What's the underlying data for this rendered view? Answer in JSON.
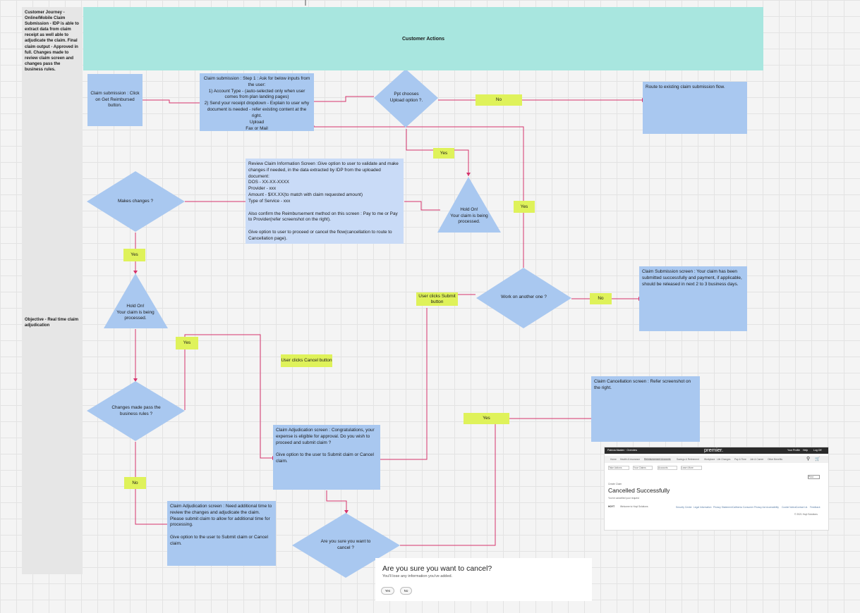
{
  "lane": {
    "row1_label": "Customer Journey - Online/Mobile  Claim Submission - IDP is able to extract data from claim receipt as well able to adjudicate the claim. Final claim output - Approved in full. Changes made to review claim screen and changes pass the business rules.",
    "row2_label": "Objective - Real time claim adjudication",
    "header_title": "Customer Actions"
  },
  "nodes": {
    "click_reimbursed": "Claim submission : Click on Get Reimbursed button.",
    "step1": "Claim submission : Step 1 : Ask for below inputs from the user:\n1) Account Type - (auto-selected only when user comes from plan landing pages)\n2) Send your receipt dropdown - Explain to user why document is needed - refer existing content at the right.\nUpload\nFax or Mail",
    "ppt_chooses": "Ppt chooses Upload option ?.",
    "route_existing": "Route to existing claim submission flow.",
    "review_screen": "Review Claim Information Screen :Give option to user to validate and make changes if needed, in the data extracted by IDP from the uploaded document:\nDOS - XX-XX-XXXX\nProvider - xxx\nAmount - $XX.XX(to match with claim requested amount)\nType of Service - xxx\n\nAlso confirm the Reimbursement method on this screen : Pay to me or Pay to Provider(refer screenshot on the right).\n\nGive option to user to proceed or cancel the flow(cancellation to route to Cancellation page).",
    "makes_changes": "Makes changes ?",
    "hold_on_1": "Hold On!\nYour claim is being processed.",
    "hold_on_2": "Hold On!\nYour claim is being processed.",
    "work_another": "Work on another one ?",
    "submission_screen": "Claim Submission screen : Your claim has been submitted successfully and payment, if applicable, should be released in next 2 to 3 business days.",
    "user_submit": "User clicks Submit button",
    "user_cancel": "User clicks Cancel button",
    "changes_pass": "Changes made pass the business rules ?",
    "adjudication_congrats": "Claim Adjudication screen : Congratulations, your expense is eligible for approval. Do you wish to proceed and submit claim ?\n\nGive option to the user to Submit claim or Cancel claim.",
    "cancellation_screen": "Claim Cancellation screen : Refer screenshot on the right.",
    "adjudication_more_time": "Claim Adjudication screen : Need additional time to review the changes and adjudicate the claim. Please submit claim to allow for additional time for processing.\n\nGive option to the user to Submit claim or Cancel claim.",
    "sure_cancel": "Are you sure you want to cancel ?"
  },
  "labels": {
    "no_1": "No",
    "yes_1": "Yes",
    "yes_2": "Yes",
    "yes_3": "Yes",
    "no_2": "No",
    "yes_4": "Yes",
    "no_3": "No",
    "yes_5": "Yes"
  },
  "cancel_dialog": {
    "title": "Are you sure you want to cancel?",
    "subtitle": "You'll lose any information you've added.",
    "yes_button": "Yes",
    "no_button": "No"
  },
  "mock_screen": {
    "brand": "premier.",
    "top_left": "Patricia Maaten · Overview",
    "top_right_1": "Your Profile",
    "top_right_2": "Help",
    "top_right_3": "Log Off",
    "nav": [
      "Home",
      "Health & Insurance",
      "Reimbursement Accounts",
      "Savings & Retirement",
      "Workplace",
      "Life Changes",
      "Pay & Time",
      "Job & Career",
      "Other Benefits"
    ],
    "filters": [
      "Take Actions",
      "Your Claims",
      "Accounts",
      "Learn More"
    ],
    "print": "Print",
    "breadcrumb": "Create Claim",
    "heading": "Cancelled Successfully",
    "message": "You've cancelled your request",
    "footer_brand": "HOYT",
    "footer_text": "Welcome to Hoyt Solutions",
    "footer_links": [
      "Security Center",
      "Legal Information",
      "Privacy Statement",
      "California Consumer Privacy Act",
      "Accessibility",
      "Cookie Notice",
      "Contact Us",
      "Feedback"
    ],
    "copyright": "© 2021 Hoyt Solutions"
  },
  "colors": {
    "teal": "#a8e6df",
    "blue_box": "#a9c8f0",
    "green_label": "#dff25a",
    "connector": "#d6336c"
  }
}
